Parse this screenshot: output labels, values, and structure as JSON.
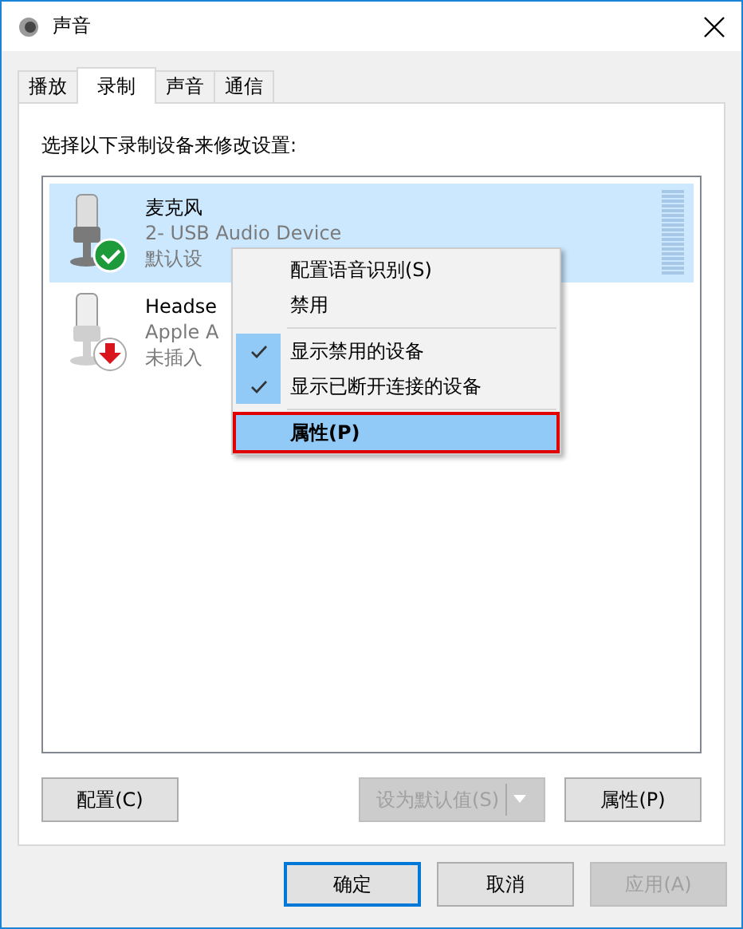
{
  "window": {
    "title": "声音"
  },
  "tabs": [
    {
      "label": "播放",
      "selected": false
    },
    {
      "label": "录制",
      "selected": true
    },
    {
      "label": "声音",
      "selected": false
    },
    {
      "label": "通信",
      "selected": false
    }
  ],
  "instruction": "选择以下录制设备来修改设置:",
  "devices": [
    {
      "name": "麦克风",
      "detail": "2- USB Audio Device",
      "status_text": "默认设",
      "kind": "default",
      "selected": true,
      "level": 0
    },
    {
      "name": "Headse",
      "detail": "Apple A",
      "status_text": "未插入",
      "kind": "unplugged",
      "selected": false
    }
  ],
  "context_menu": [
    {
      "kind": "item",
      "label": "配置语音识别(S)",
      "checked": false,
      "selected": false
    },
    {
      "kind": "item",
      "label": "禁用",
      "checked": false,
      "selected": false
    },
    {
      "kind": "separator"
    },
    {
      "kind": "item",
      "label": "显示禁用的设备",
      "checked": true,
      "selected": false
    },
    {
      "kind": "item",
      "label": "显示已断开连接的设备",
      "checked": true,
      "selected": false
    },
    {
      "kind": "separator"
    },
    {
      "kind": "item",
      "label": "属性(P)",
      "checked": false,
      "selected": true
    }
  ],
  "panel_buttons": [
    {
      "label": "配置(C)",
      "disabled": false
    },
    {
      "label": "设为默认值(S)",
      "disabled": true,
      "dropdown": true
    },
    {
      "label": "属性(P)",
      "disabled": false
    }
  ],
  "dialog_buttons": [
    {
      "label": "确定",
      "disabled": false,
      "default": true
    },
    {
      "label": "取消",
      "disabled": false,
      "default": false
    },
    {
      "label": "应用(A)",
      "disabled": true,
      "default": false
    }
  ]
}
